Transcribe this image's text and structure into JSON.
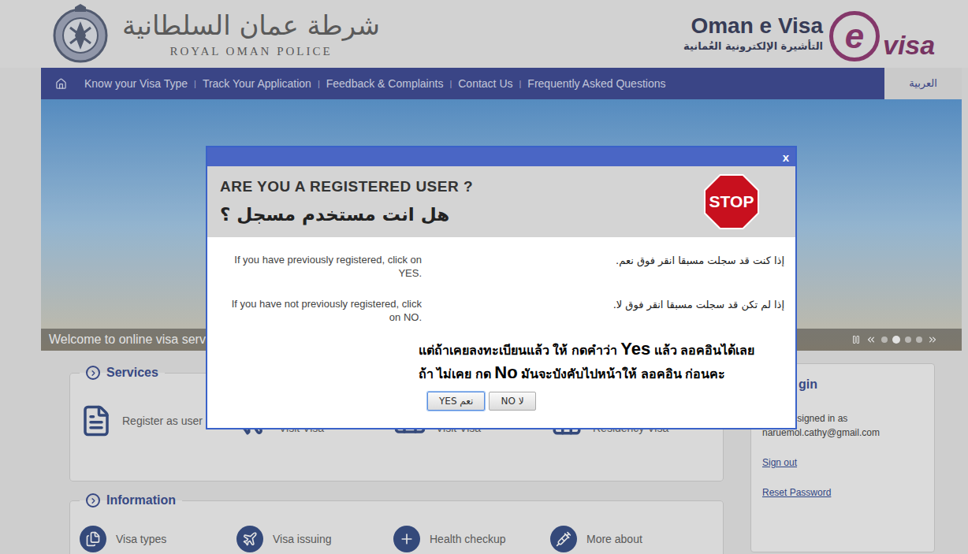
{
  "header": {
    "org_ar": "شرطة عمان السلطانية",
    "org_en": "ROYAL OMAN POLICE",
    "brand": "Oman e Visa",
    "brand_ar": "التأشيرة الإلكترونية العُمانية",
    "logo_mark": "e",
    "logo_sub": "visa"
  },
  "nav": {
    "items": [
      "Know your Visa Type",
      "Track Your Application",
      "Feedback & Complaints",
      "Contact Us",
      "Frequently Asked Questions"
    ],
    "separator": "|",
    "language": "العربية"
  },
  "banner": {
    "caption": "Welcome to online visa serv",
    "dots": [
      {
        "selected": false
      },
      {
        "selected": true
      },
      {
        "selected": false
      },
      {
        "selected": false
      }
    ]
  },
  "services": {
    "title": "Services",
    "items": [
      "Register as user",
      "Apply for a Tourist Visit Visa",
      "Apply for a Work Visit Visa",
      "Apply for a Residency Visa"
    ]
  },
  "information": {
    "title": "Information",
    "items": [
      "Visa types",
      "Visa issuing",
      "Health checkup",
      "More about"
    ]
  },
  "login": {
    "title": "gin",
    "signed_in_label": "You are signed in as",
    "email": "naruemol.cathy@gmail.com",
    "links": [
      "Sign out",
      "Reset Password"
    ]
  },
  "modal": {
    "close": "x",
    "title": "ARE YOU A REGISTERED USER ?",
    "title_ar": "هل انت مستخدم مسجل ؟",
    "stop": "STOP",
    "lines": [
      {
        "en": "If you have previously registered, click on YES.",
        "ar": "إذا كنت قد سجلت مسبقا انقر فوق نعم."
      },
      {
        "en": "If you have not previously registered, click on NO.",
        "ar": "إذا لم تكن قد سجلت مسبقا انقر فوق لا."
      }
    ],
    "note": [
      {
        "text": "แต่ถ้าเคยลงทะเบียนแล้ว ให้ กดคำว่า ",
        "emphasis": false
      },
      {
        "text": "Yes",
        "emphasis": true
      },
      {
        "text": " แล้ว ลอคอินได้เลย  ถ้า ไม่เคย กด ",
        "emphasis": false
      },
      {
        "text": "No",
        "emphasis": true
      },
      {
        "text": " มันจะบังคับไปหน้าให้ ลอคอิน ก่อนคะ",
        "emphasis": false
      }
    ],
    "buttons": [
      {
        "label": "YES نعم",
        "selected": true
      },
      {
        "label": "NO لا",
        "selected": false
      }
    ]
  }
}
